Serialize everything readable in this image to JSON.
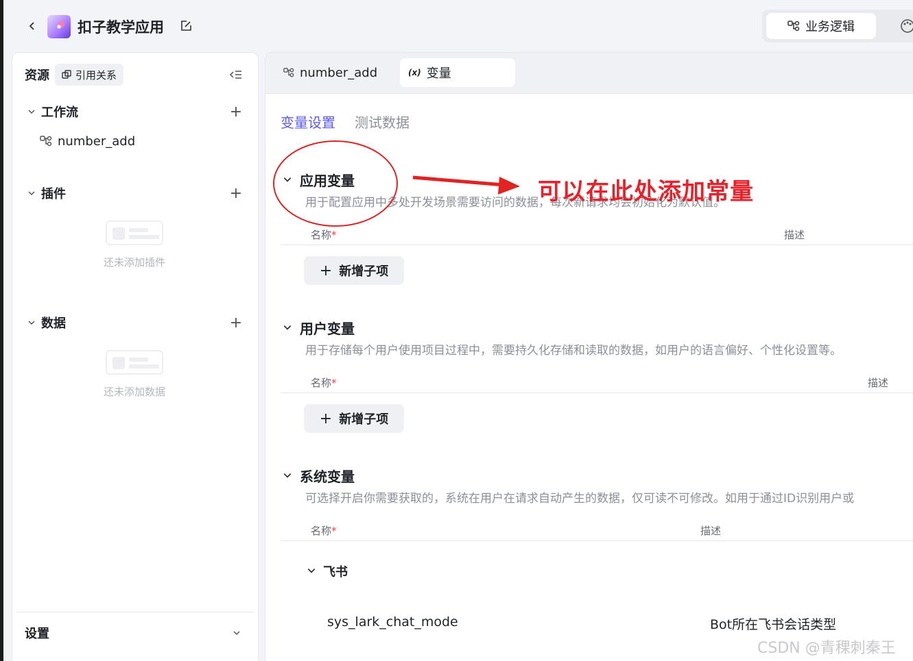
{
  "header": {
    "app_title": "扣子教学应用",
    "biz_logic_label": "业务逻辑"
  },
  "sidebar": {
    "title": "资源",
    "ref_btn_label": "引用关系",
    "workflow": {
      "label": "工作流",
      "items": [
        "number_add"
      ]
    },
    "plugin": {
      "label": "插件",
      "empty_text": "还未添加插件"
    },
    "data": {
      "label": "数据",
      "empty_text": "还未添加数据"
    },
    "settings_label": "设置"
  },
  "main": {
    "tabs": [
      {
        "label": "number_add"
      },
      {
        "label": "变量"
      }
    ],
    "subtabs": [
      "变量设置",
      "测试数据"
    ],
    "sections": {
      "app": {
        "title": "应用变量",
        "desc": "用于配置应用中多处开发场景需要访问的数据，每次新请求均会初始化为默认值。",
        "col_name": "名称",
        "col_desc": "描述",
        "add_label": "新增子项"
      },
      "user": {
        "title": "用户变量",
        "desc": "用于存储每个用户使用项目过程中，需要持久化存储和读取的数据，如用户的语言偏好、个性化设置等。",
        "col_name": "名称",
        "col_desc": "描述",
        "add_label": "新增子项"
      },
      "system": {
        "title": "系统变量",
        "desc": "可选择开启你需要获取的，系统在用户在请求自动产生的数据，仅可读不可修改。如用于通过ID识别用户或",
        "col_name": "名称",
        "col_desc": "描述",
        "group": "飞书",
        "rows": [
          {
            "name": "sys_lark_chat_mode",
            "desc": "Bot所在飞书会话类型"
          }
        ]
      }
    }
  },
  "annotation": {
    "text": "可以在此处添加常量",
    "color": "#e8222b"
  },
  "watermark": "CSDN @青稞刺秦王",
  "colors": {
    "accent": "#5b5bf0",
    "required": "#e54848"
  }
}
